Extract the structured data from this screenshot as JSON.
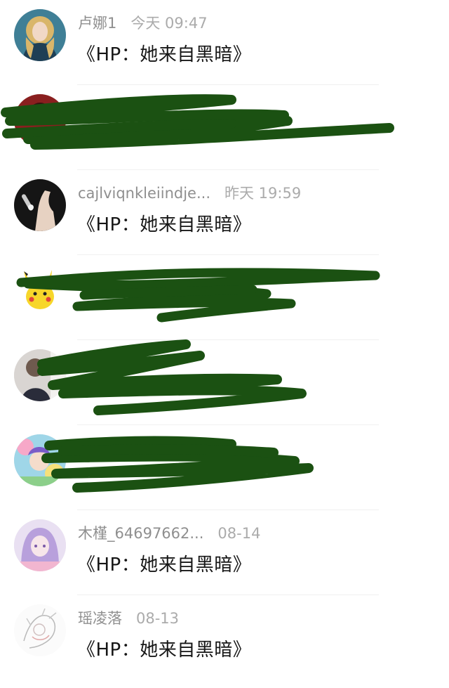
{
  "messages": [
    {
      "name": "卢娜1",
      "time": "今天 09:47",
      "text": "《HP：她来自黑暗》",
      "avatar": "avatar-blonde-girl",
      "redacted": false
    },
    {
      "name": "",
      "time": "",
      "text": "",
      "avatar": "avatar-dark-red",
      "redacted": true
    },
    {
      "name": "cajlviqnkleiindje...",
      "time": "昨天 19:59",
      "text": "《HP：她来自黑暗》",
      "avatar": "avatar-hand-dark",
      "redacted": false
    },
    {
      "name": "",
      "time": "",
      "text": "",
      "avatar": "avatar-pikachu",
      "redacted": true
    },
    {
      "name": "",
      "time": "",
      "text": "",
      "avatar": "avatar-gray-photo",
      "redacted": true
    },
    {
      "name": "",
      "time": "",
      "text": "",
      "avatar": "avatar-colorful-anime",
      "redacted": true
    },
    {
      "name": "木槿_64697662...",
      "time": "08-14",
      "text": "《HP：她来自黑暗》",
      "avatar": "avatar-purple-anime",
      "redacted": false
    },
    {
      "name": "瑶凌落",
      "time": "08-13",
      "text": "《HP：她来自黑暗》",
      "avatar": "avatar-white-sketch",
      "redacted": false
    }
  ],
  "redaction_color": "#1b5112"
}
